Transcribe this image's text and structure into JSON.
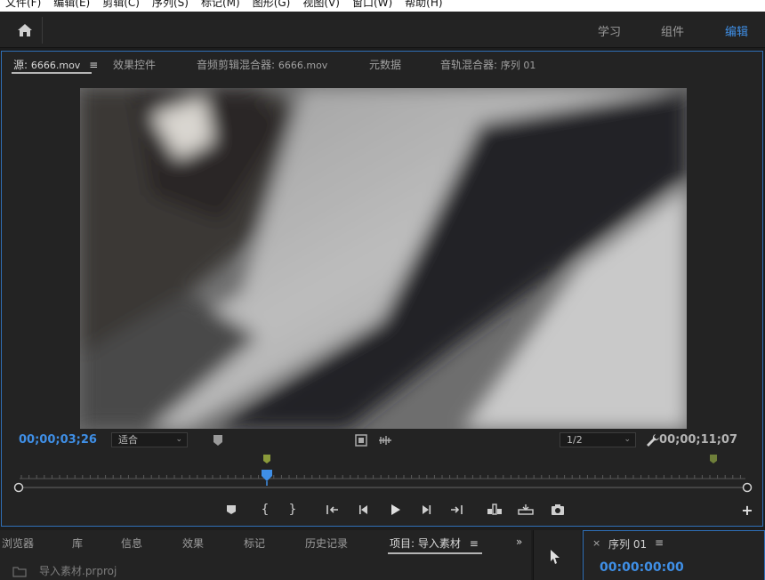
{
  "menu": [
    "文件(F)",
    "编辑(E)",
    "剪辑(C)",
    "序列(S)",
    "标记(M)",
    "图形(G)",
    "视图(V)",
    "窗口(W)",
    "帮助(H)"
  ],
  "workspaces": {
    "learn": "学习",
    "assemble": "组件",
    "edit": "编辑"
  },
  "source_tabs": {
    "source": "源:",
    "source_file": "6666.mov",
    "effect_controls": "效果控件",
    "audio_clip_mixer": "音频剪辑混合器:",
    "audio_clip_mixer_file": "6666.mov",
    "metadata": "元数据",
    "audio_track_mixer": "音轨混合器:",
    "audio_track_mixer_seq": "序列 01"
  },
  "source_monitor": {
    "current_timecode": "00;00;03;26",
    "zoom": "适合",
    "resolution": "1/2",
    "duration_timecode": "00;00;11;07"
  },
  "bottom_tabs": {
    "browser": "浏览器",
    "libraries": "库",
    "info": "信息",
    "effects": "效果",
    "markers": "标记",
    "history": "历史记录",
    "project": "项目: 导入素材"
  },
  "project": {
    "file": "导入素材.prproj"
  },
  "sequence": {
    "title": "序列 01",
    "timecode": "00:00:00:00"
  },
  "colors": {
    "accent": "#3f8fe6",
    "panel": "#232323",
    "background": "#1d1d1d"
  }
}
